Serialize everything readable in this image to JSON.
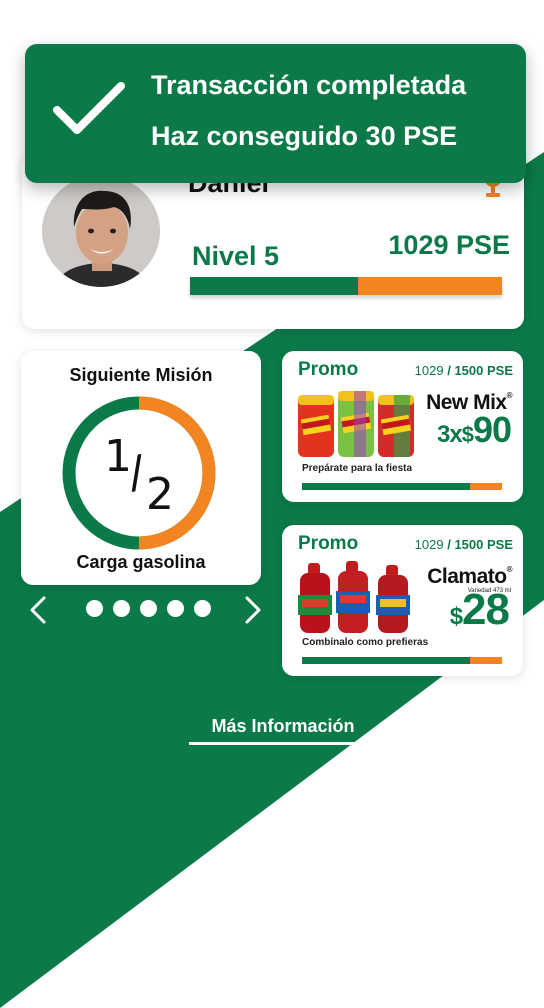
{
  "toast": {
    "title": "Transacción completada",
    "message_prefix": "Haz conseguido",
    "message_value": "30 PSE"
  },
  "profile": {
    "name": "Daniel",
    "level": "Nivel 5",
    "points": "1029 PSE",
    "level_progress": 0.54
  },
  "mission": {
    "title": "Siguiente Misión",
    "progress_numerator": "1",
    "progress_denominator": "2",
    "progress_fraction": 0.5,
    "task": "Carga gasolina"
  },
  "carousel": {
    "dot_count": 5
  },
  "promos": [
    {
      "title": "Promo",
      "current": "1029",
      "separator": "/",
      "goal": "1500 PSE",
      "brand": "New Mix",
      "quantity": "3x",
      "currency": "$",
      "price": "90",
      "tagline": "Prepárate para la fiesta",
      "progress": 0.84
    },
    {
      "title": "Promo",
      "current": "1029",
      "separator": "/",
      "goal": "1500 PSE",
      "brand": "Clamato",
      "size_note": "Variedad 473 ml",
      "currency": "$",
      "price": "28",
      "tagline": "Combínalo como prefieras",
      "progress": 0.84
    }
  ],
  "more_info": "Más Información",
  "colors": {
    "green": "#0b7a48",
    "orange": "#f28522",
    "white": "#ffffff"
  }
}
